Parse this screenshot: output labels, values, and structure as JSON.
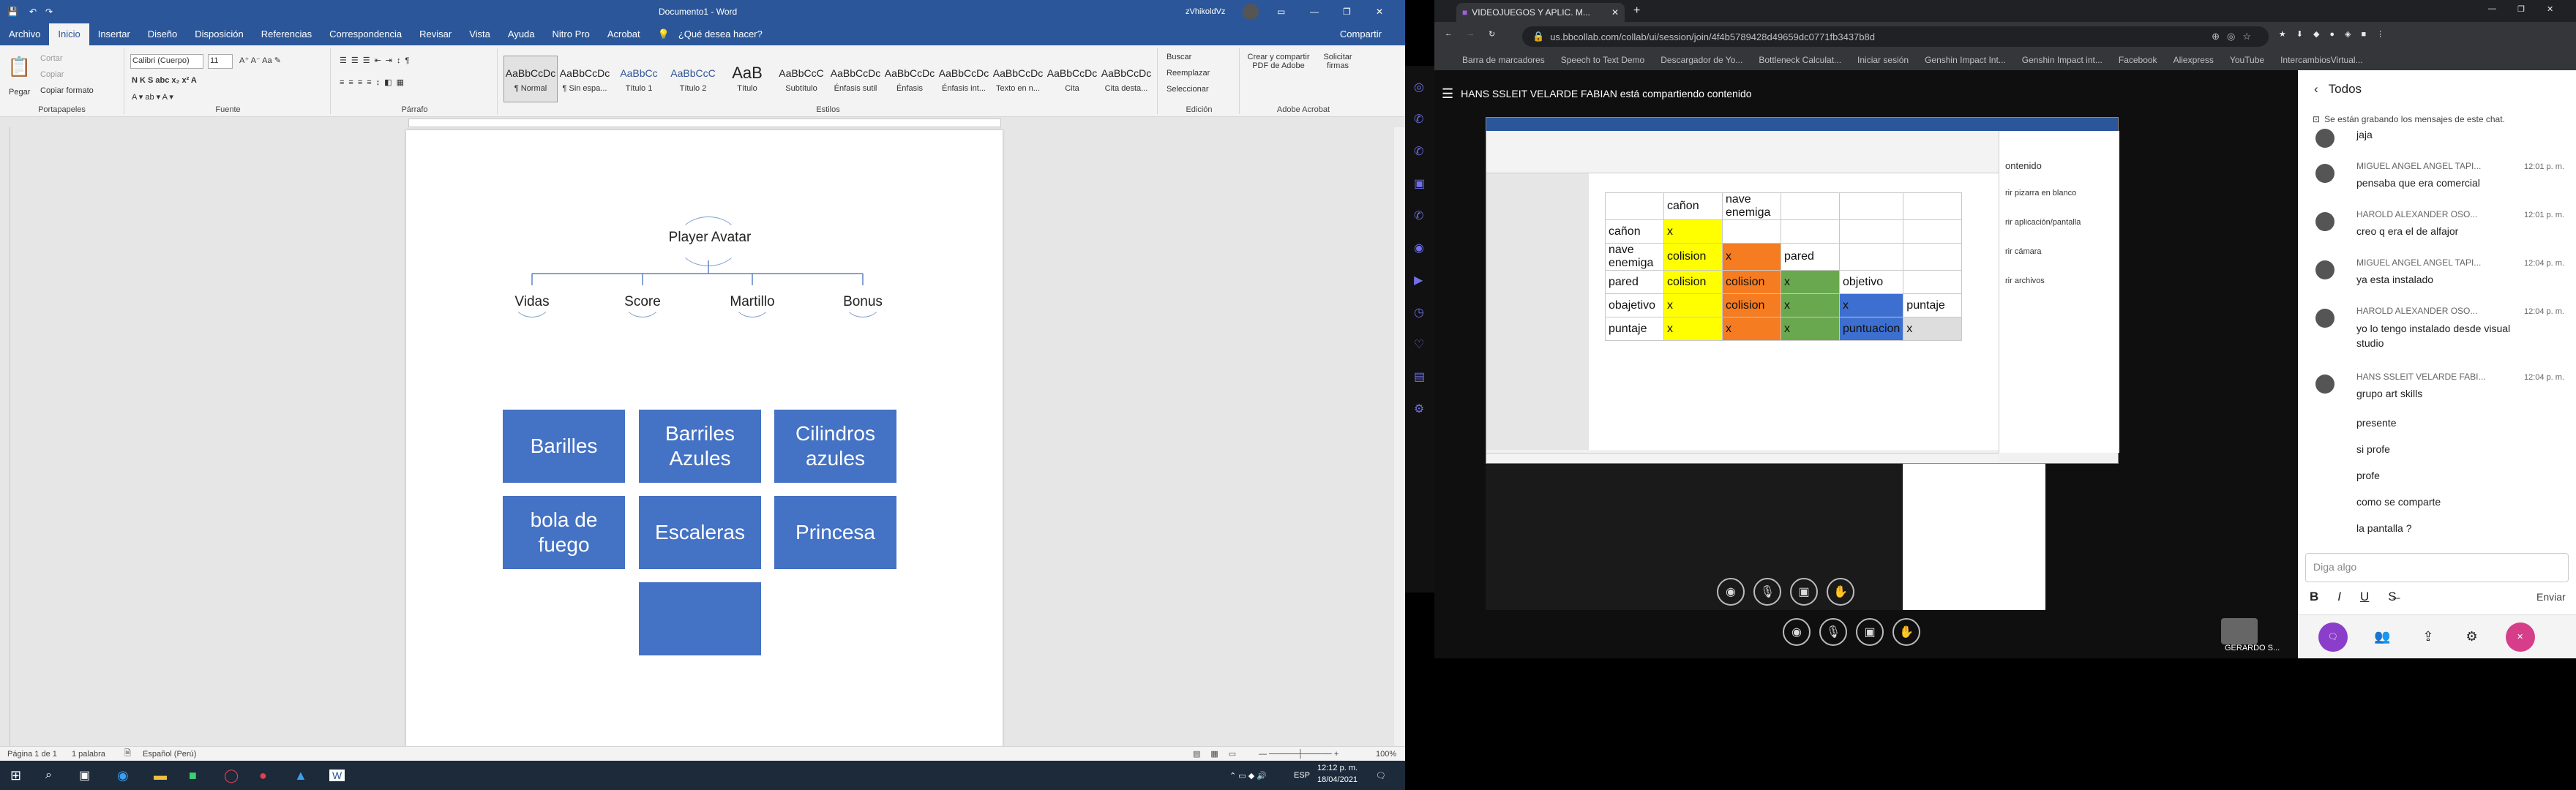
{
  "word": {
    "title": "Documento1 - Word",
    "user": "zVhikoldVz",
    "tabs": [
      "Archivo",
      "Inicio",
      "Insertar",
      "Diseño",
      "Disposición",
      "Referencias",
      "Correspondencia",
      "Revisar",
      "Vista",
      "Ayuda",
      "Nitro Pro",
      "Acrobat"
    ],
    "tell_me": "¿Qué desea hacer?",
    "share": "Compartir",
    "clipboard": {
      "paste": "Pegar",
      "cut": "Cortar",
      "copy": "Copiar",
      "format": "Copiar formato",
      "label": "Portapapeles"
    },
    "font": {
      "name": "Calibri (Cuerpo)",
      "size": "11",
      "label": "Fuente"
    },
    "paragraph_label": "Párrafo",
    "styles": [
      {
        "preview": "AaBbCcDc",
        "name": "¶ Normal"
      },
      {
        "preview": "AaBbCcDc",
        "name": "¶ Sin espa..."
      },
      {
        "preview": "AaBbCc",
        "name": "Título 1"
      },
      {
        "preview": "AaBbCcC",
        "name": "Título 2"
      },
      {
        "preview": "AaB",
        "name": "Título"
      },
      {
        "preview": "AaBbCcC",
        "name": "Subtítulo"
      },
      {
        "preview": "AaBbCcDc",
        "name": "Énfasis sutil"
      },
      {
        "preview": "AaBbCcDc",
        "name": "Énfasis"
      },
      {
        "preview": "AaBbCcDc",
        "name": "Énfasis int..."
      },
      {
        "preview": "AaBbCcDc",
        "name": "Texto en n..."
      },
      {
        "preview": "AaBbCcDc",
        "name": "Cita"
      },
      {
        "preview": "AaBbCcDc",
        "name": "Cita desta..."
      }
    ],
    "styles_label": "Estilos",
    "edit": {
      "find": "Buscar",
      "replace": "Reemplazar",
      "select": "Seleccionar",
      "label": "Edición"
    },
    "acrobat": {
      "create": "Crear y compartir PDF de Adobe",
      "request": "Solicitar firmas",
      "label": "Adobe Acrobat"
    },
    "org": {
      "root": "Player Avatar",
      "children": [
        "Vidas",
        "Score",
        "Martillo",
        "Bonus"
      ]
    },
    "boxes": [
      "Barilles",
      "Barriles Azules",
      "Cilindros azules",
      "bola de fuego",
      "Escaleras",
      "Princesa",
      ""
    ],
    "status": {
      "page": "Página 1 de 1",
      "words": "1 palabra",
      "lang": "Español (Perú)",
      "zoom": "100%"
    }
  },
  "taskbar": {
    "time": "12:12 p. m.",
    "date": "18/04/2021",
    "lang": "ESP"
  },
  "chrome": {
    "tab_title": "VIDEOJUEGOS Y APLIC. M...",
    "url": "us.bbcollab.com/collab/ui/session/join/4f4b5789428d49659dc0771fb3437b8d",
    "bookmarks": [
      "Barra de marcadores",
      "Speech to Text Demo",
      "Descargador de Yo...",
      "Bottleneck Calculat...",
      "Iniciar sesión",
      "Genshin Impact Int...",
      "Genshin Impact int...",
      "Facebook",
      "Aliexpress",
      "YouTube",
      "IntercambiosVirtual..."
    ],
    "sharing": "HANS SSLEIT VELARDE FABIAN está compartiendo contenido",
    "presenter": "GERARDO S...",
    "shared_table": {
      "rows": [
        [
          "",
          "cañon",
          "nave enemiga",
          "",
          "",
          ""
        ],
        [
          "cañon",
          "x",
          "",
          "",
          "",
          ""
        ],
        [
          "nave enemiga",
          "colision",
          "x",
          "pared",
          "",
          ""
        ],
        [
          "pared",
          "colision",
          "colision",
          "x",
          "objetivo",
          ""
        ],
        [
          "obajetivo",
          "x",
          "colision",
          "x",
          "x",
          "puntaje"
        ],
        [
          "puntaje",
          "x",
          "x",
          "x",
          "puntuacion",
          "x"
        ]
      ]
    },
    "panel": {
      "title": "ontenido",
      "items": [
        "rir pizarra en blanco",
        "rir aplicación/pantalla",
        "rir cámara",
        "rir archivos"
      ]
    }
  },
  "chat": {
    "title": "Todos",
    "notice": "Se están grabando los mensajes de este chat.",
    "messages": [
      {
        "name": "",
        "time": "",
        "text": "jaja"
      },
      {
        "name": "MIGUEL ANGEL ANGEL TAPI...",
        "time": "12:01 p. m.",
        "text": "pensaba que era comercial"
      },
      {
        "name": "HAROLD ALEXANDER OSO...",
        "time": "12:01 p. m.",
        "text": "creo q era el de alfajor"
      },
      {
        "name": "MIGUEL ANGEL ANGEL TAPI...",
        "time": "12:04 p. m.",
        "text": "ya esta instalado"
      },
      {
        "name": "HAROLD ALEXANDER OSO...",
        "time": "12:04 p. m.",
        "text": "yo lo tengo instalado desde visual studio"
      },
      {
        "name": "HANS SSLEIT VELARDE FABI...",
        "time": "12:04 p. m.",
        "text": "grupo art skills"
      }
    ],
    "simple": [
      "presente",
      "si profe",
      "profe",
      "como se comparte",
      "la pantalla ?"
    ],
    "input_placeholder": "Diga algo",
    "send": "Enviar"
  }
}
